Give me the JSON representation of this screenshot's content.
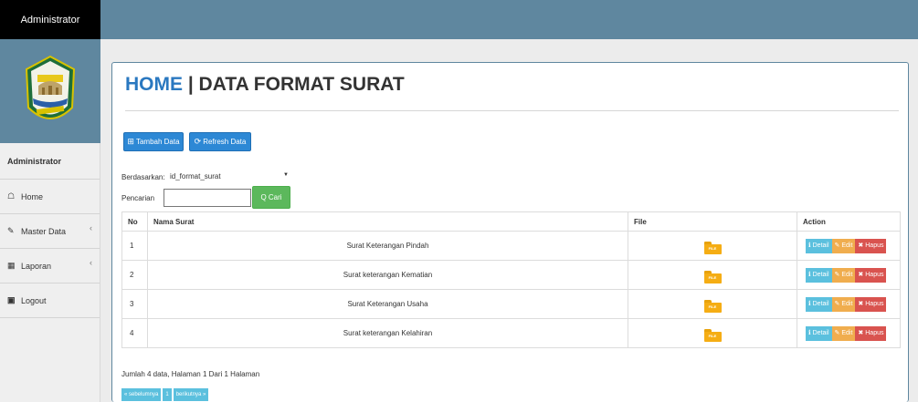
{
  "header": {
    "brand": "Administrator"
  },
  "sidebar": {
    "title": "Administrator",
    "items": [
      {
        "label": "Home",
        "icon": "home-icon",
        "has_submenu": false
      },
      {
        "label": "Master Data",
        "icon": "edit-icon",
        "has_submenu": true
      },
      {
        "label": "Laporan",
        "icon": "calendar-icon",
        "has_submenu": true
      },
      {
        "label": "Logout",
        "icon": "logout-icon",
        "has_submenu": false
      }
    ]
  },
  "main": {
    "title_home": "HOME",
    "title_sep": " | ",
    "title_page": "DATA FORMAT SURAT",
    "buttons": {
      "add": "Tambah Data",
      "refresh": "Refresh Data"
    },
    "filter": {
      "by_label": "Berdasarkan:",
      "by_value": "id_format_surat",
      "search_label": "Pencarian",
      "search_value": "",
      "search_button": "Q Cari"
    },
    "table": {
      "columns": [
        "No",
        "Nama Surat",
        "File",
        "Action"
      ],
      "rows": [
        {
          "no": "1",
          "nama": "Surat Keterangan Pindah",
          "file": "FILE"
        },
        {
          "no": "2",
          "nama": "Surat keterangan Kematian",
          "file": "FILE"
        },
        {
          "no": "3",
          "nama": "Surat Keterangan Usaha",
          "file": "FILE"
        },
        {
          "no": "4",
          "nama": "Surat keterangan Kelahiran",
          "file": "FILE"
        }
      ],
      "actions": {
        "detail": "Detail",
        "edit": "Edit",
        "hapus": "Hapus"
      }
    },
    "summary": "Jumlah 4 data, Halaman 1 Dari 1 Halaman",
    "pagination": {
      "prev": "« sebelumnya",
      "page": "1",
      "next": "berikutnya »"
    }
  },
  "colors": {
    "topbar": "#5f879f",
    "primary": "#2d88d5",
    "success": "#5cb85c",
    "info": "#5bc0de",
    "warning": "#f0ad4e",
    "danger": "#d9534f"
  }
}
